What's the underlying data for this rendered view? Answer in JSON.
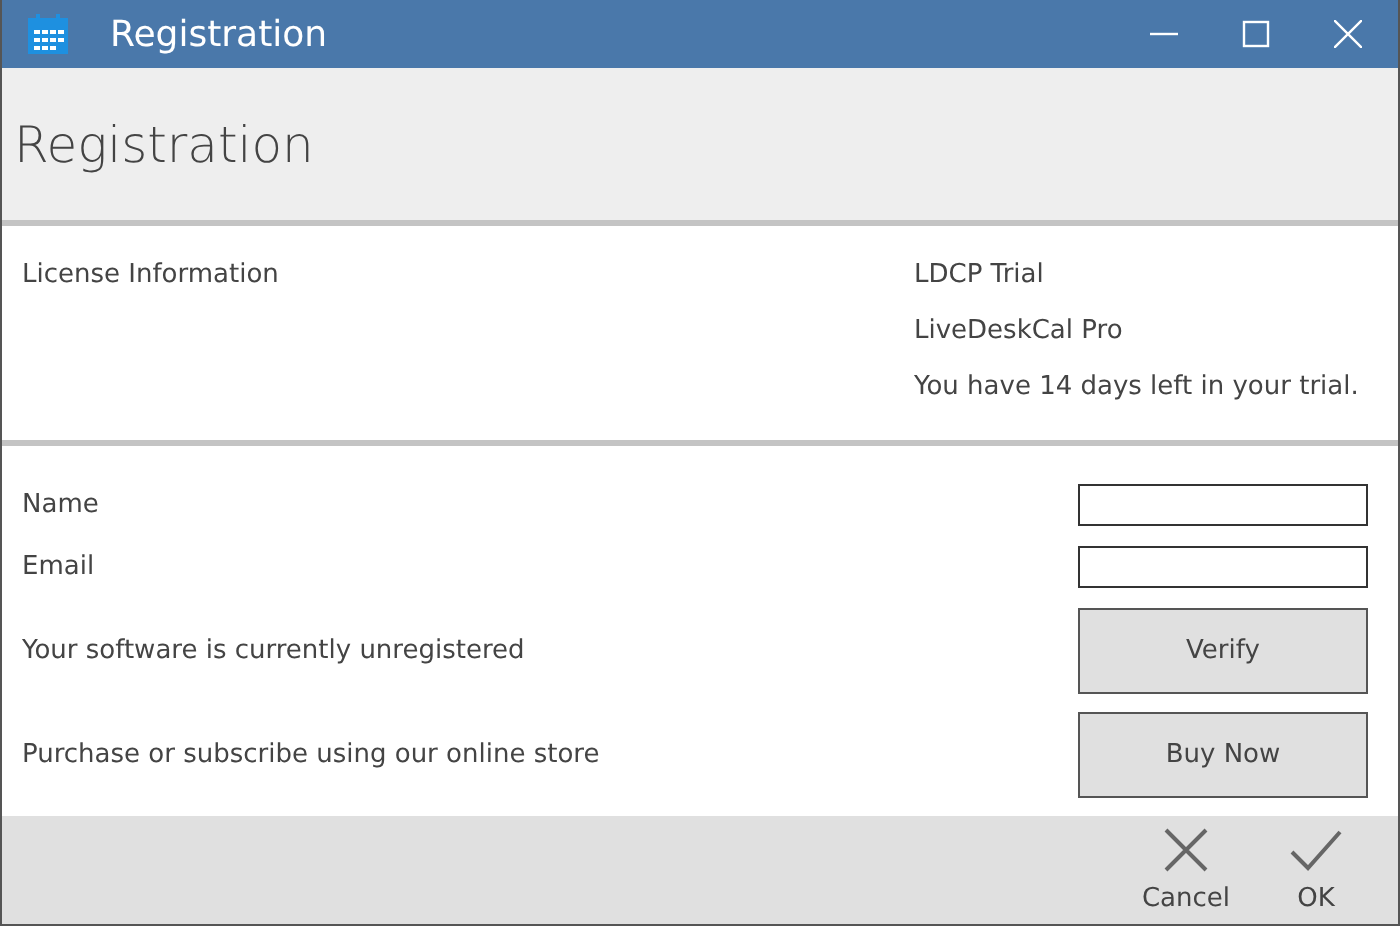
{
  "window": {
    "title": "Registration"
  },
  "header": {
    "title": "Registration"
  },
  "license": {
    "label": "License Information",
    "lines": [
      "LDCP Trial",
      "LiveDeskCal Pro",
      "You have 14 days left in your trial."
    ]
  },
  "form": {
    "fields": [
      {
        "label": "Name"
      },
      {
        "label": "Email"
      }
    ],
    "actions": [
      {
        "text": "Your software is currently unregistered",
        "button": "Verify"
      },
      {
        "text": "Purchase or subscribe using our online store",
        "button": "Buy Now"
      }
    ]
  },
  "footer": {
    "buttons": [
      {
        "kind": "cancel",
        "label": "Cancel"
      },
      {
        "kind": "ok",
        "label": "OK"
      }
    ]
  }
}
